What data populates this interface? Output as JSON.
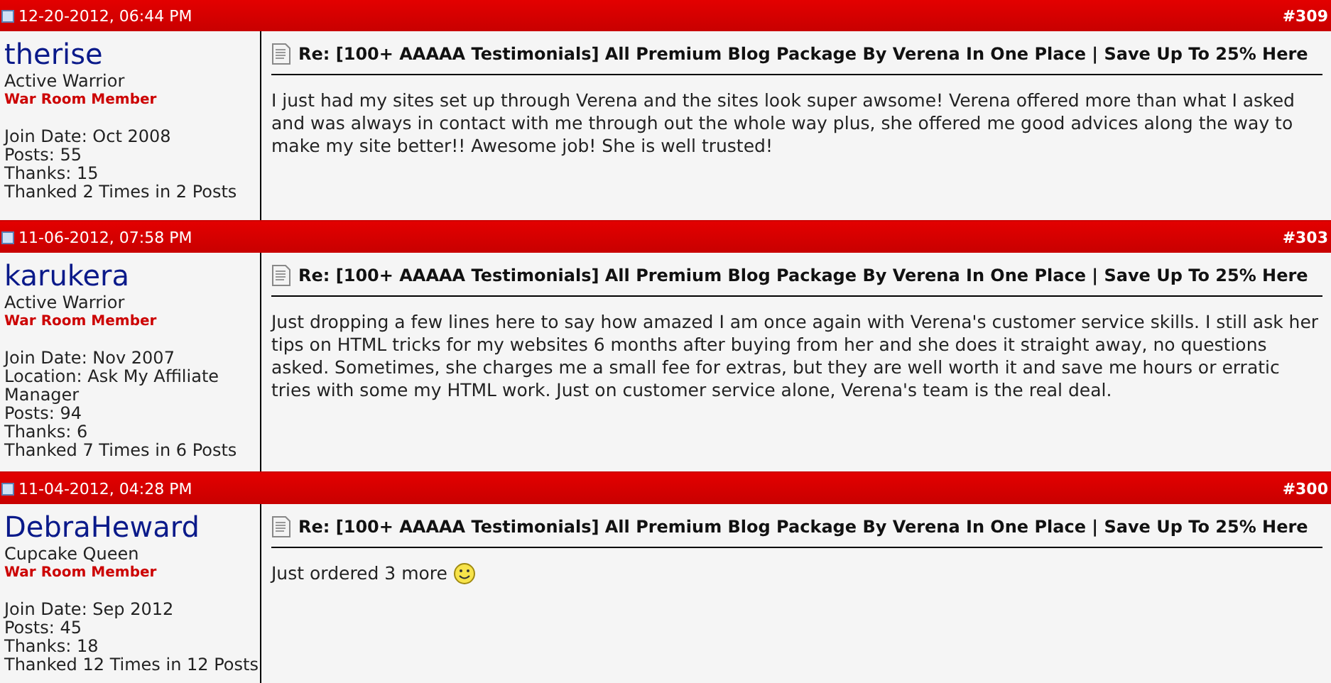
{
  "posts": [
    {
      "date": "12-20-2012, 06:44 PM",
      "number": "#309",
      "username": "therise",
      "user_title": "Active Warrior",
      "group": "War Room Member",
      "details": [
        "Join Date: Oct 2008",
        "Posts: 55",
        "Thanks: 15",
        "Thanked 2 Times in 2 Posts"
      ],
      "title": "Re: [100+ AAAAA Testimonials] All Premium Blog Package By Verena In One Place | Save Up To 25% Here",
      "message": "I just had my sites set up through Verena and the sites look super awsome! Verena offered more than what I asked and was always in contact with me through out the whole way plus, she offered me good advices along the way to make my site better!! Awesome job! She is well trusted!",
      "smiley": false
    },
    {
      "date": "11-06-2012, 07:58 PM",
      "number": "#303",
      "username": "karukera",
      "user_title": "Active Warrior",
      "group": "War Room Member",
      "details": [
        "Join Date: Nov 2007",
        "Location: Ask My Affiliate Manager",
        "Posts: 94",
        "Thanks: 6",
        "Thanked 7 Times in 6 Posts"
      ],
      "title": "Re: [100+ AAAAA Testimonials] All Premium Blog Package By Verena In One Place | Save Up To 25% Here",
      "message": "Just dropping a few lines here to say how amazed I am once again with Verena's customer service skills. I still ask her tips on HTML tricks for my websites 6 months after buying from her and she does it straight away, no questions asked. Sometimes, she charges me a small fee for extras, but they are well worth it and save me hours or erratic tries with some my HTML work. Just on customer service alone, Verena's team is the real deal.",
      "smiley": false
    },
    {
      "date": "11-04-2012, 04:28 PM",
      "number": "#300",
      "username": "DebraHeward",
      "user_title": "Cupcake Queen",
      "group": "War Room Member",
      "details": [
        "Join Date: Sep 2012",
        "Posts: 45",
        "Thanks: 18",
        "Thanked 12 Times in 12 Posts"
      ],
      "title": "Re: [100+ AAAAA Testimonials] All Premium Blog Package By Verena In One Place | Save Up To 25% Here",
      "message": "Just ordered 3 more",
      "smiley": true
    }
  ]
}
